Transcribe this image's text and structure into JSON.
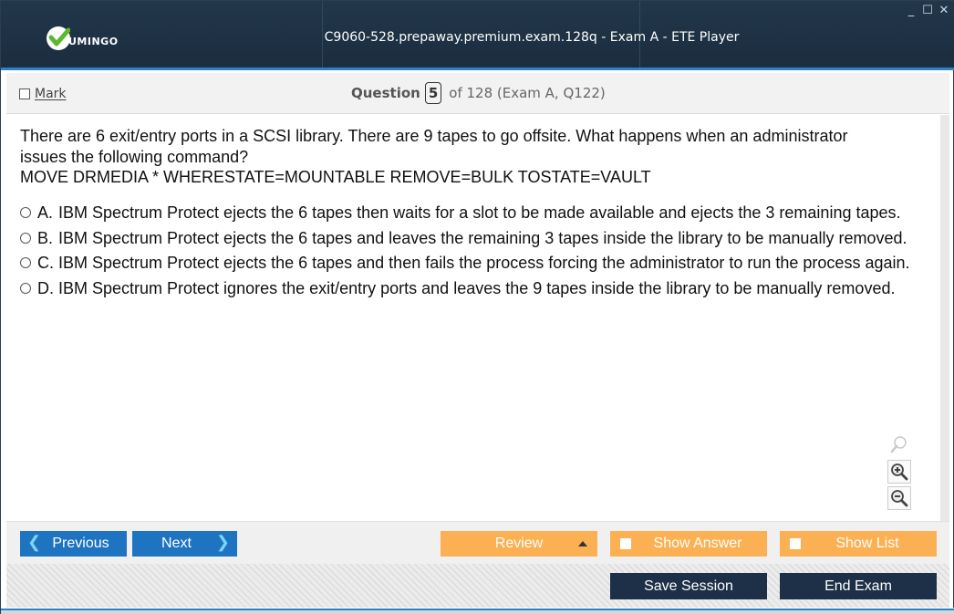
{
  "window": {
    "title": "C9060-528.prepaway.premium.exam.128q - Exam A - ETE Player",
    "logo_text": "UMINGO",
    "controls": {
      "minimize": "_",
      "maximize": "☐",
      "close": "✕"
    }
  },
  "header": {
    "mark_label": "Mark",
    "question_word": "Question",
    "question_number": "5",
    "question_total": "of 128 (Exam A, Q122)"
  },
  "question": {
    "text_line1": "There are 6 exit/entry ports in a SCSI library. There are 9 tapes to go offsite. What happens when an administrator issues the following command?",
    "text_line2": "MOVE DRMEDIA * WHERESTATE=MOUNTABLE REMOVE=BULK TOSTATE=VAULT",
    "options": [
      {
        "letter": "A.",
        "text": "IBM Spectrum Protect ejects the 6 tapes then waits for a slot to be made available and ejects the 3 remaining tapes."
      },
      {
        "letter": "B.",
        "text": "IBM Spectrum Protect ejects the 6 tapes and leaves the remaining 3 tapes inside the library to be manually removed."
      },
      {
        "letter": "C.",
        "text": "IBM Spectrum Protect ejects the 6 tapes and then fails the process forcing the administrator to run the process again."
      },
      {
        "letter": "D.",
        "text": "IBM Spectrum Protect ignores the exit/entry ports and leaves the 9 tapes inside the library to be manually removed."
      }
    ]
  },
  "nav": {
    "previous_label": "Previous",
    "next_label": "Next",
    "review_label": "Review",
    "show_answer_label": "Show Answer",
    "show_list_label": "Show List",
    "save_session_label": "Save Session",
    "end_exam_label": "End Exam"
  },
  "colors": {
    "titlebar": "#1b2d3f",
    "accent_blue": "#1f74c1",
    "orange": "#fbb153",
    "dark_button": "#1d3047"
  }
}
